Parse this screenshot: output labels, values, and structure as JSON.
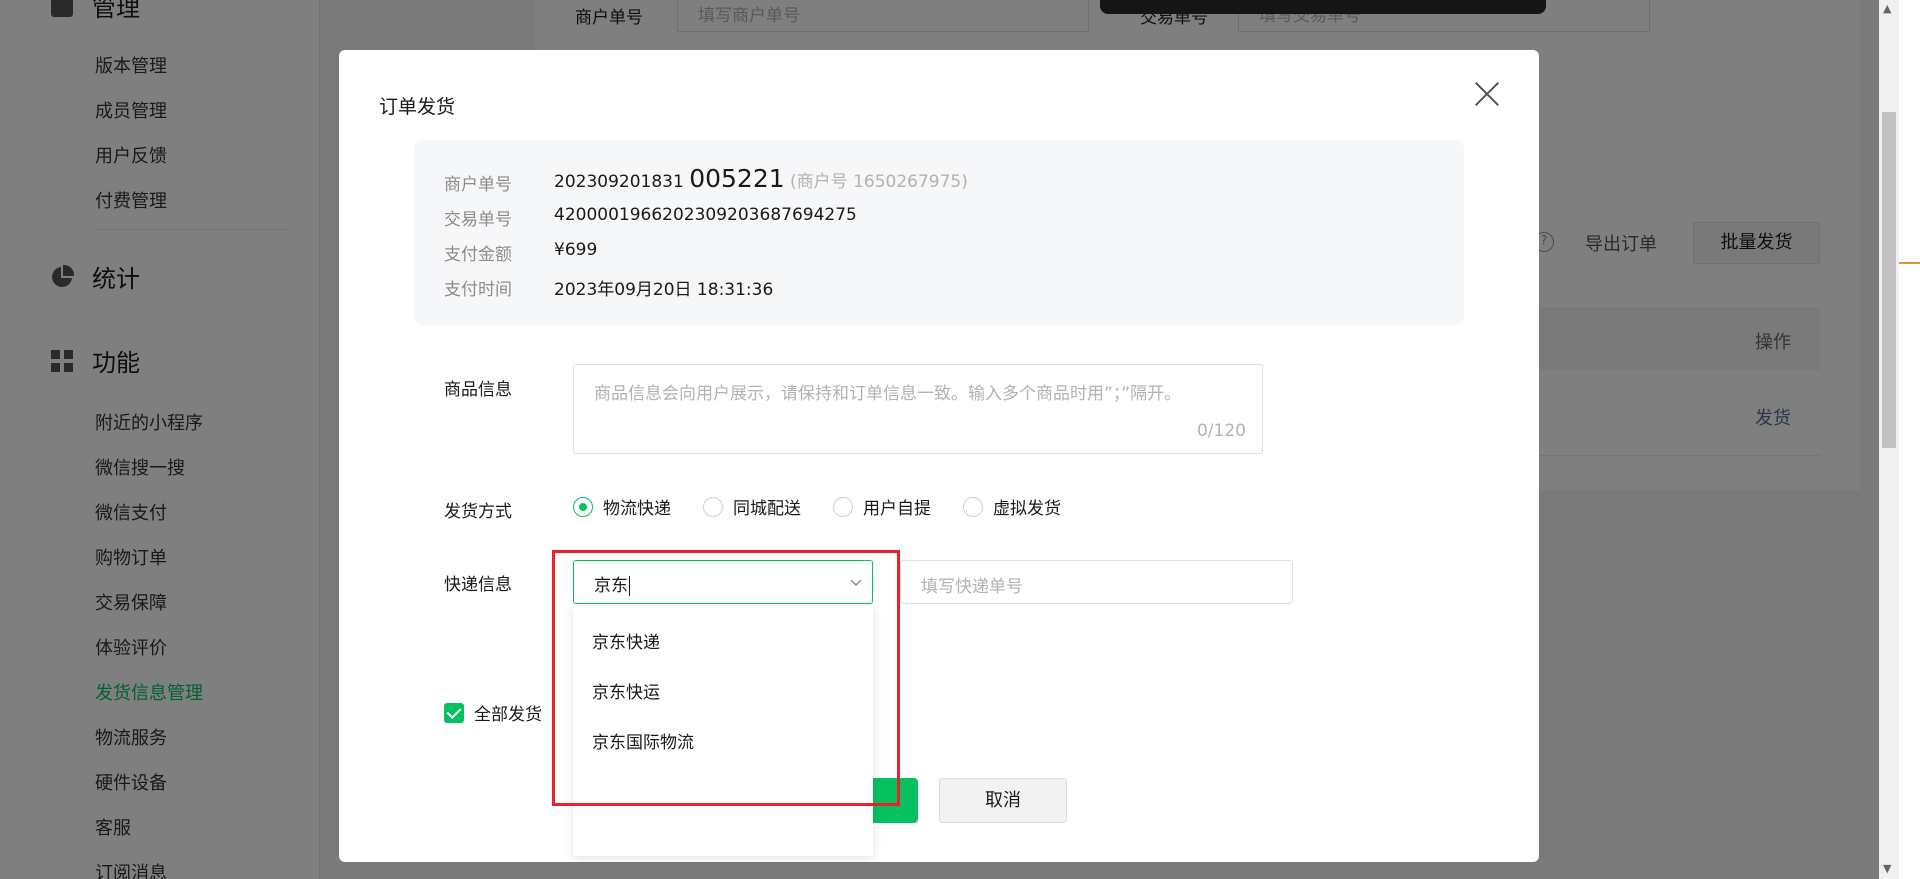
{
  "sidebar": {
    "top_item_label": "管理",
    "manage_items": [
      "版本管理",
      "成员管理",
      "用户反馈",
      "付费管理"
    ],
    "stats_label": "统计",
    "features_label": "功能",
    "feature_items": [
      "附近的小程序",
      "微信搜一搜",
      "微信支付",
      "购物订单",
      "交易保障",
      "体验评价",
      "发货信息管理",
      "物流服务",
      "硬件设备",
      "客服",
      "订阅消息"
    ],
    "active_item": "发货信息管理"
  },
  "background_page": {
    "merchant_order_label": "商户单号",
    "merchant_order_placeholder": "填写商户单号",
    "trade_no_label": "交易单号",
    "trade_no_placeholder": "填写交易单号",
    "help_icon": "?",
    "export_label": "导出订单",
    "batch_ship_label": "批量发货",
    "column_operation": "操作",
    "row_action": "发货"
  },
  "modal": {
    "title": "订单发货",
    "info": {
      "merchant_order_label": "商户单号",
      "merchant_order_prefix": "202309201831",
      "merchant_order_suffix": "005221",
      "merchant_no": "(商户号 1650267975)",
      "trade_no_label": "交易单号",
      "trade_no": "4200001966202309203687694275",
      "amount_label": "支付金额",
      "amount": "¥699",
      "pay_time_label": "支付时间",
      "pay_time": "2023年09月20日 18:31:36"
    },
    "goods_label": "商品信息",
    "goods_placeholder": "商品信息会向用户展示，请保持和订单信息一致。输入多个商品时用”；”隔开。",
    "goods_count": "0/120",
    "ship_method_label": "发货方式",
    "ship_methods": [
      "物流快递",
      "同城配送",
      "用户自提",
      "虚拟发货"
    ],
    "selected_ship_method": "物流快递",
    "express_label": "快递信息",
    "express_input_value": "京东",
    "tracking_placeholder": "填写快递单号",
    "dropdown_options": [
      "京东快递",
      "京东快运",
      "京东国际物流"
    ],
    "ship_all_label": "全部发货",
    "ship_all_checked": true,
    "cancel_label": "取消"
  },
  "colors": {
    "accent": "#07c160",
    "highlight": "#e8232e",
    "link": "#576b95"
  }
}
